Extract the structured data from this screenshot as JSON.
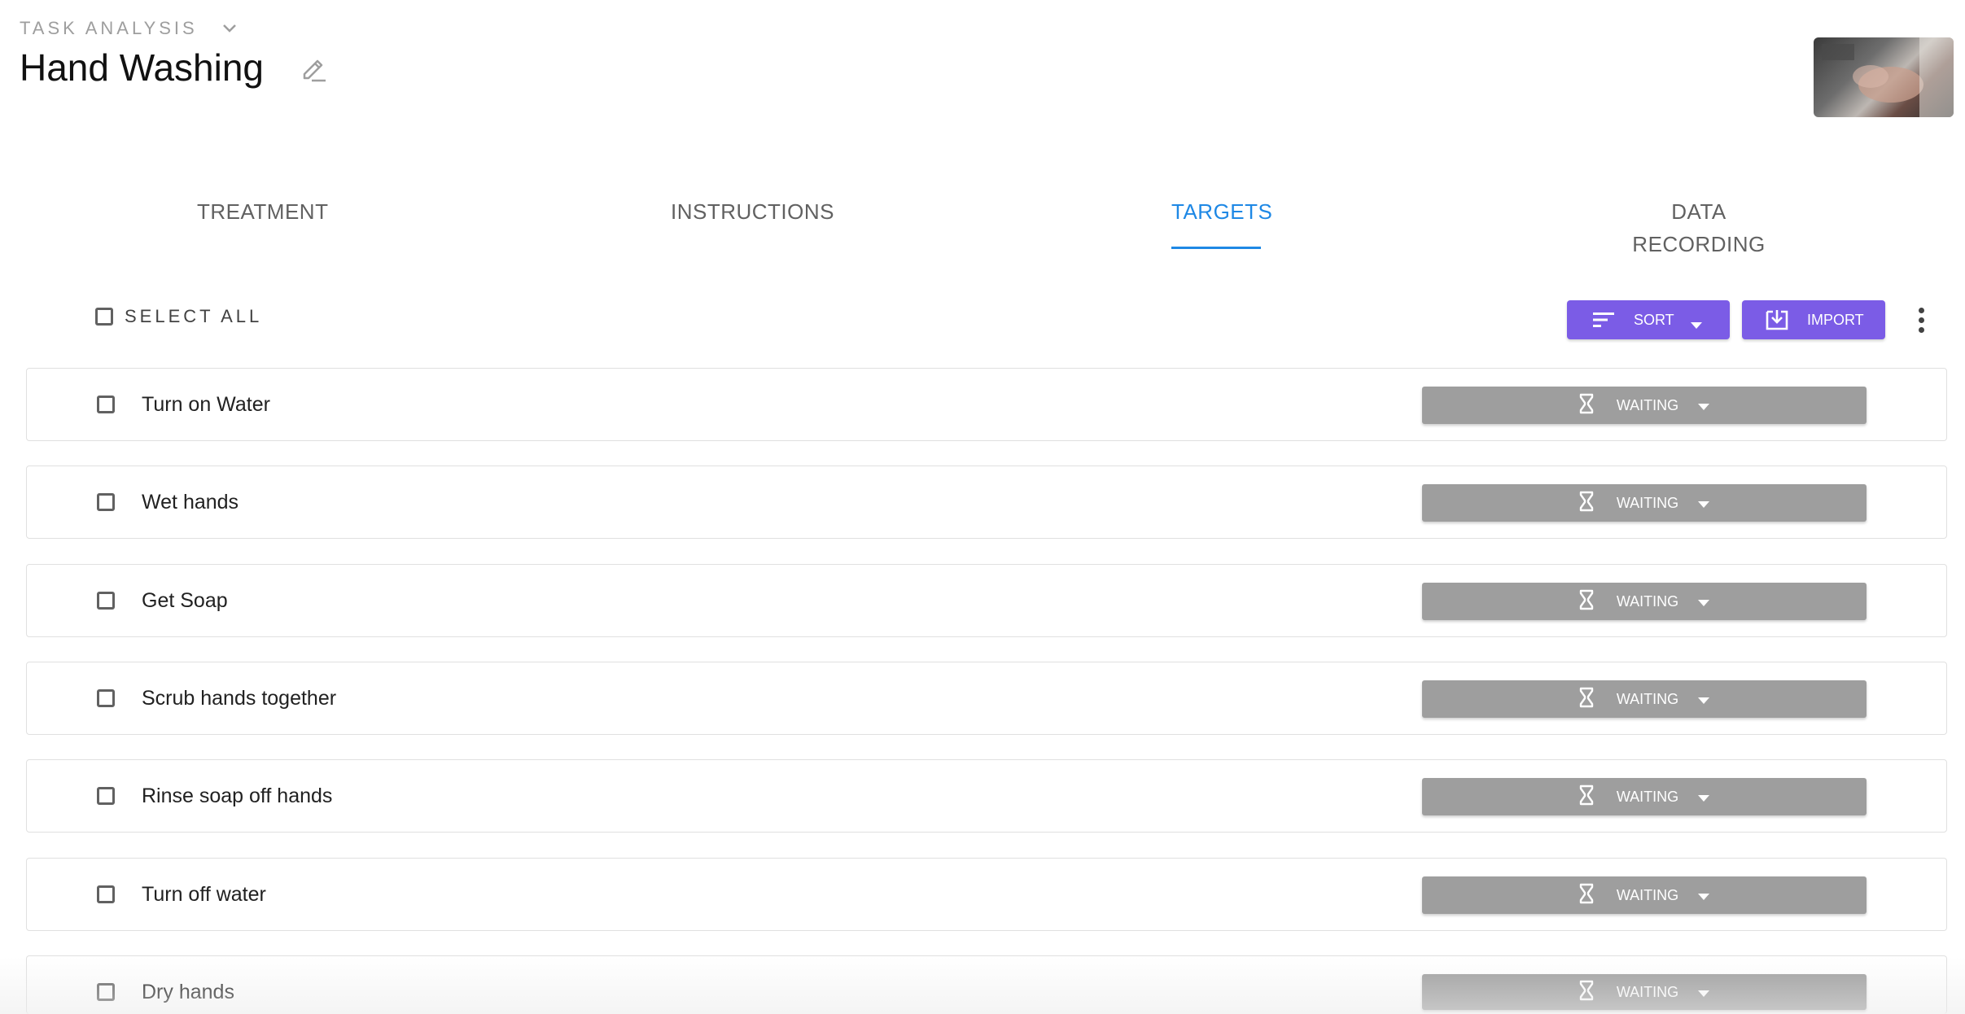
{
  "header": {
    "section_label": "Task Analysis",
    "title": "Hand Washing"
  },
  "tabs": [
    {
      "label": "Treatment",
      "active": false
    },
    {
      "label": "Instructions",
      "active": false
    },
    {
      "label": "Targets",
      "active": true
    },
    {
      "label": "Data Recording",
      "active": false
    }
  ],
  "toolbar": {
    "select_all_label": "Select all",
    "sort_label": "Sort",
    "import_label": "Import"
  },
  "targets": [
    {
      "label": "Turn on Water",
      "status": "Waiting"
    },
    {
      "label": "Wet hands",
      "status": "Waiting"
    },
    {
      "label": "Get Soap",
      "status": "Waiting"
    },
    {
      "label": "Scrub hands together",
      "status": "Waiting"
    },
    {
      "label": "Rinse soap off hands",
      "status": "Waiting"
    },
    {
      "label": "Turn off water",
      "status": "Waiting"
    },
    {
      "label": "Dry hands",
      "status": "Waiting"
    }
  ],
  "colors": {
    "accent_blue": "#1e88e5",
    "button_purple": "#7b5ce6",
    "status_gray": "#9e9e9e"
  },
  "icons": {
    "section_toggle": "chevron-down-icon",
    "edit": "pencil-icon",
    "sort": "sort-lines-icon",
    "import": "import-icon",
    "more": "more-vertical-icon",
    "status": "hourglass-icon",
    "dropdown": "caret-down-icon"
  }
}
